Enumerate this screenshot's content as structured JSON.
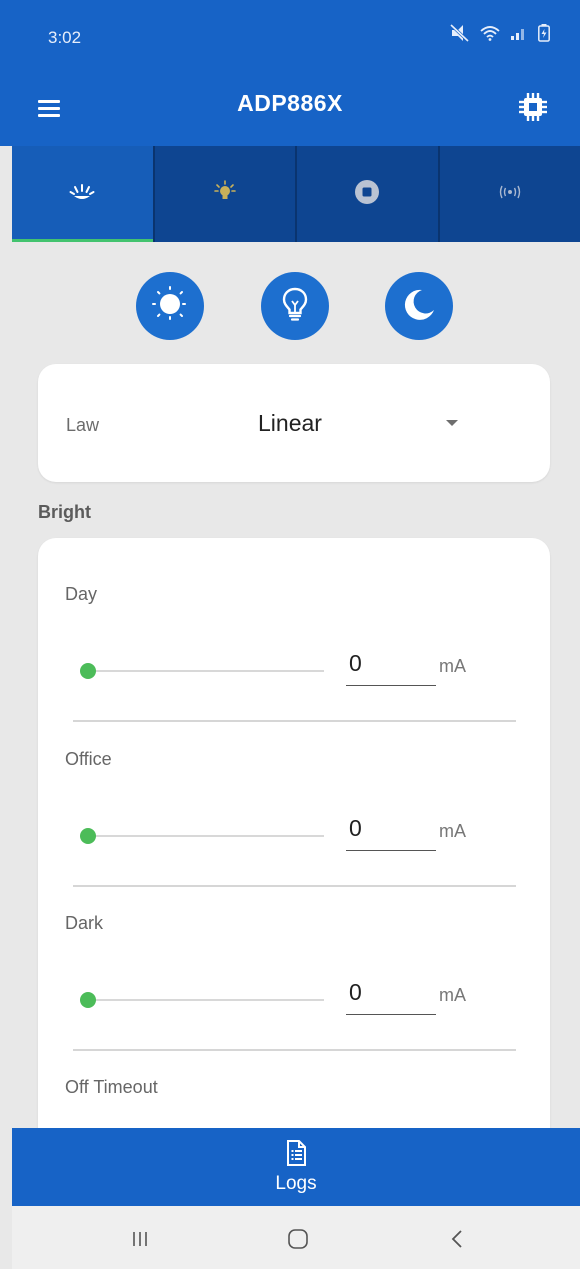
{
  "status_bar": {
    "time": "3:02",
    "icons": [
      "mute-icon",
      "wifi-icon",
      "signal-icon",
      "battery-icon"
    ]
  },
  "app_bar": {
    "title": "ADP886X",
    "left_icon": "menu-icon",
    "right_icon": "chip-icon"
  },
  "tabs": [
    {
      "icon": "light-rays-icon",
      "active": true
    },
    {
      "icon": "bulb-small-icon",
      "active": false
    },
    {
      "icon": "stop-icon",
      "active": false
    },
    {
      "icon": "broadcast-icon",
      "active": false
    }
  ],
  "mode_buttons": [
    {
      "icon": "sun-icon"
    },
    {
      "icon": "bulb-icon"
    },
    {
      "icon": "moon-icon"
    }
  ],
  "law": {
    "label": "Law",
    "value": "Linear"
  },
  "bright": {
    "title": "Bright",
    "rows": [
      {
        "label": "Day",
        "value": "0",
        "unit": "mA",
        "slider_fraction": 0
      },
      {
        "label": "Office",
        "value": "0",
        "unit": "mA",
        "slider_fraction": 0
      },
      {
        "label": "Dark",
        "value": "0",
        "unit": "mA",
        "slider_fraction": 0
      }
    ],
    "last_label": "Off Timeout"
  },
  "bottom_bar": {
    "label": "Logs",
    "icon": "document-list-icon"
  },
  "nav_bar": {
    "icons": [
      "recent-apps-icon",
      "home-icon",
      "back-icon"
    ]
  },
  "colors": {
    "primary": "#1763c6",
    "tab_dark": "#0e4591",
    "tab_active": "#165db8",
    "accent": "#4cbc59",
    "background": "#e8e8e8"
  }
}
